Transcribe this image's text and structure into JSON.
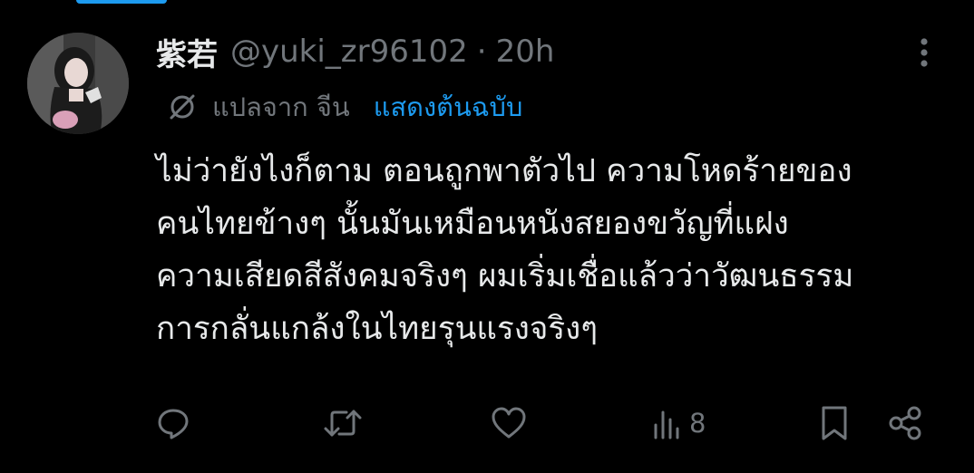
{
  "user": {
    "display_name": "紫若",
    "handle": "@yuki_zr96102",
    "separator": "·",
    "time": "20h"
  },
  "translation": {
    "translated_from": "แปลจาก จีน",
    "show_original": "แสดงต้นฉบับ"
  },
  "tweet": {
    "lines": [
      "ไม่ว่ายังไงก็ตาม ตอนถูกพาตัวไป ความโหดร้ายของ",
      "คนไทยข้างๆ นั้นมันเหมือนหนังสยองขวัญที่แฝง",
      "ความเสียดสีสังคมจริงๆ ผมเริ่มเชื่อแล้วว่าวัฒนธรรม",
      "การกลั่นแกล้งในไทยรุนแรงจริงๆ"
    ]
  },
  "actions": {
    "views_count": "8"
  },
  "icons": {
    "more": "more-vertical-icon",
    "translate": "translate-icon",
    "reply": "reply-icon",
    "retweet": "retweet-icon",
    "like": "heart-icon",
    "views": "views-icon",
    "bookmark": "bookmark-icon",
    "share": "share-icon"
  },
  "colors": {
    "background": "#000000",
    "text_primary": "#e7e9ea",
    "text_secondary": "#71767b",
    "accent": "#1d9bf0"
  }
}
